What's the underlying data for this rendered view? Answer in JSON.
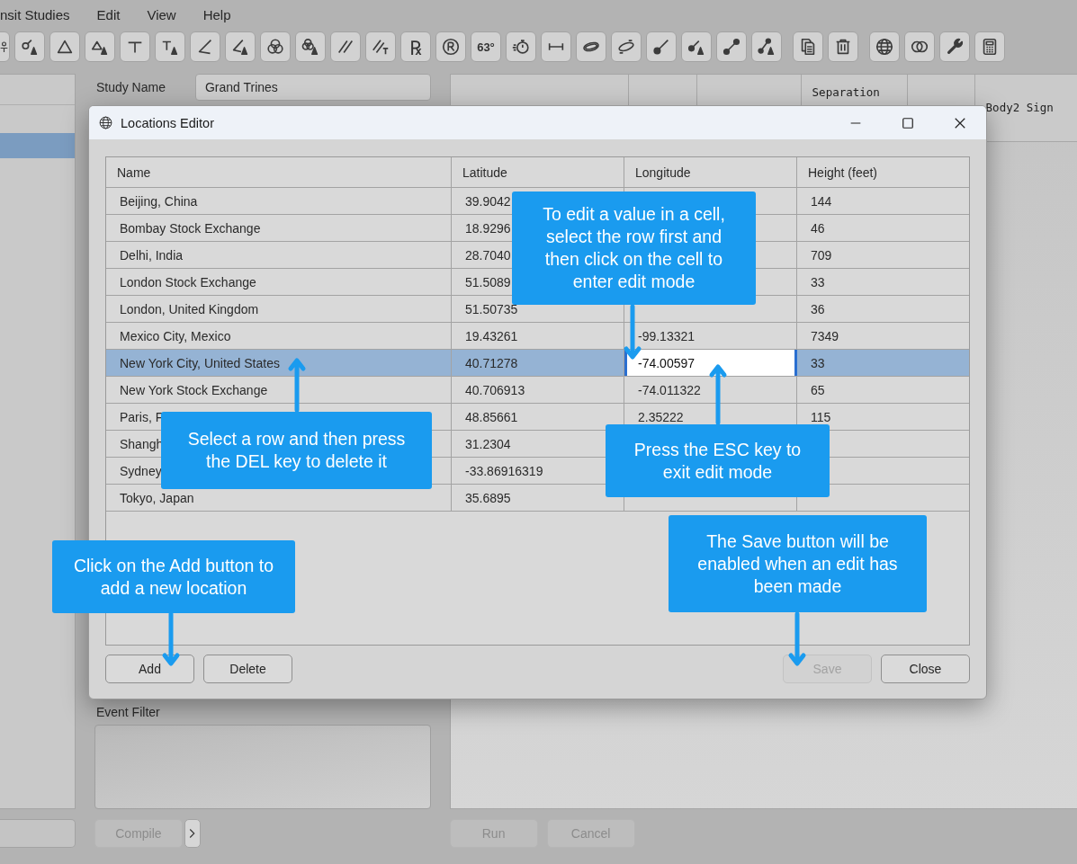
{
  "menu": [
    {
      "label": "nsit Studies"
    },
    {
      "label": "Edit"
    },
    {
      "label": "View"
    },
    {
      "label": "Help"
    }
  ],
  "toolbar": {
    "groups": [
      {
        "buttons": [
          {
            "kind": "icon"
          },
          {
            "kind": "icon"
          },
          {
            "kind": "icon"
          },
          {
            "kind": "icon"
          },
          {
            "kind": "icon"
          },
          {
            "kind": "icon"
          },
          {
            "kind": "icon"
          },
          {
            "kind": "icon"
          },
          {
            "kind": "icon"
          },
          {
            "kind": "icon"
          },
          {
            "kind": "icon"
          },
          {
            "kind": "icon"
          },
          {
            "kind": "text",
            "label": "℞"
          },
          {
            "kind": "icon"
          },
          {
            "kind": "text",
            "label": "63°"
          },
          {
            "kind": "icon"
          },
          {
            "kind": "icon"
          },
          {
            "kind": "icon"
          },
          {
            "kind": "icon"
          },
          {
            "kind": "icon"
          },
          {
            "kind": "icon"
          },
          {
            "kind": "icon"
          },
          {
            "kind": "icon"
          }
        ]
      },
      {
        "buttons": [
          {
            "kind": "icon"
          },
          {
            "kind": "icon"
          }
        ]
      },
      {
        "buttons": [
          {
            "kind": "icon"
          },
          {
            "kind": "icon"
          },
          {
            "kind": "icon"
          },
          {
            "kind": "icon"
          }
        ]
      }
    ]
  },
  "sidebar": {
    "rows": [
      {
        "selected": true
      }
    ]
  },
  "study": {
    "label": "Study Name",
    "value": "Grand Trines"
  },
  "results_table": {
    "columns": [
      {},
      {},
      {},
      {
        "label": "Separation"
      },
      {},
      {
        "label": "Body2 Sign"
      }
    ]
  },
  "event_filter": {
    "label": "Event Filter"
  },
  "compile": {
    "label": "Compile",
    "disabled": true
  },
  "run_buttons": [
    {
      "label": "Run",
      "disabled": true
    },
    {
      "label": "Cancel",
      "disabled": true
    }
  ],
  "dialog": {
    "title": "Locations Editor",
    "table": {
      "columns": [
        "Name",
        "Latitude",
        "Longitude",
        "Height (feet)"
      ],
      "rows": [
        {
          "selected": false,
          "cells": [
            {
              "text": "Beijing, China",
              "editing": false
            },
            {
              "text": "39.9042",
              "editing": false
            },
            {
              "editing": false
            },
            {
              "text": "144",
              "editing": false
            }
          ]
        },
        {
          "selected": false,
          "cells": [
            {
              "text": "Bombay Stock Exchange",
              "editing": false
            },
            {
              "text": "18.9296",
              "editing": false
            },
            {
              "editing": false
            },
            {
              "text": "46",
              "editing": false
            }
          ]
        },
        {
          "selected": false,
          "cells": [
            {
              "text": "Delhi, India",
              "editing": false
            },
            {
              "text": "28.7040",
              "editing": false
            },
            {
              "editing": false
            },
            {
              "text": "709",
              "editing": false
            }
          ]
        },
        {
          "selected": false,
          "cells": [
            {
              "text": "London Stock Exchange",
              "editing": false
            },
            {
              "text": "51.5089",
              "editing": false
            },
            {
              "editing": false
            },
            {
              "text": "33",
              "editing": false
            }
          ]
        },
        {
          "selected": false,
          "cells": [
            {
              "text": "London, United Kingdom",
              "editing": false
            },
            {
              "text": "51.50735",
              "editing": false
            },
            {
              "editing": false
            },
            {
              "text": "36",
              "editing": false
            }
          ]
        },
        {
          "selected": false,
          "cells": [
            {
              "text": "Mexico City, Mexico",
              "editing": false
            },
            {
              "text": "19.43261",
              "editing": false
            },
            {
              "text": "-99.13321",
              "editing": false
            },
            {
              "text": "7349",
              "editing": false
            }
          ]
        },
        {
          "selected": true,
          "cells": [
            {
              "text": "New York City, United States",
              "editing": false
            },
            {
              "text": "40.71278",
              "editing": false
            },
            {
              "text": "-74.00597",
              "editing": true
            },
            {
              "text": "33",
              "editing": false
            }
          ]
        },
        {
          "selected": false,
          "cells": [
            {
              "text": "New York Stock Exchange",
              "editing": false
            },
            {
              "text": "40.706913",
              "editing": false
            },
            {
              "text": "-74.011322",
              "editing": false
            },
            {
              "text": "65",
              "editing": false
            }
          ]
        },
        {
          "selected": false,
          "cells": [
            {
              "text": "Paris, F",
              "editing": false
            },
            {
              "text": "48.85661",
              "editing": false
            },
            {
              "text": "2.35222",
              "editing": false
            },
            {
              "text": "115",
              "editing": false
            }
          ]
        },
        {
          "selected": false,
          "cells": [
            {
              "text": "Shangh",
              "editing": false
            },
            {
              "text": "31.2304",
              "editing": false
            },
            {
              "editing": false
            },
            {
              "editing": false
            }
          ]
        },
        {
          "selected": false,
          "cells": [
            {
              "text": "Sydney",
              "editing": false
            },
            {
              "text": "-33.86916319",
              "editing": false
            },
            {
              "editing": false
            },
            {
              "editing": false
            }
          ]
        },
        {
          "selected": false,
          "cells": [
            {
              "text": "Tokyo, Japan",
              "editing": false
            },
            {
              "text": "35.6895",
              "editing": false
            },
            {
              "editing": false
            },
            {
              "editing": false
            }
          ]
        }
      ]
    },
    "buttons_left": [
      {
        "label": "Add",
        "disabled": false
      },
      {
        "label": "Delete",
        "disabled": false
      }
    ],
    "buttons_right": [
      {
        "label": "Save",
        "disabled": true
      },
      {
        "label": "Close",
        "disabled": false
      }
    ]
  },
  "callouts": [
    {
      "text": "To edit a value in a cell, select the row first and then click on the cell to enter edit mode",
      "kind": "down"
    },
    {
      "text": "Select a row and then press the DEL key to delete it",
      "kind": "up"
    },
    {
      "text": "Press the ESC key to exit edit mode",
      "kind": "up"
    },
    {
      "text": "Click on the Add button to add a new location",
      "kind": "down"
    },
    {
      "text": "The Save button will be enabled when an edit has been made",
      "kind": "down"
    }
  ]
}
